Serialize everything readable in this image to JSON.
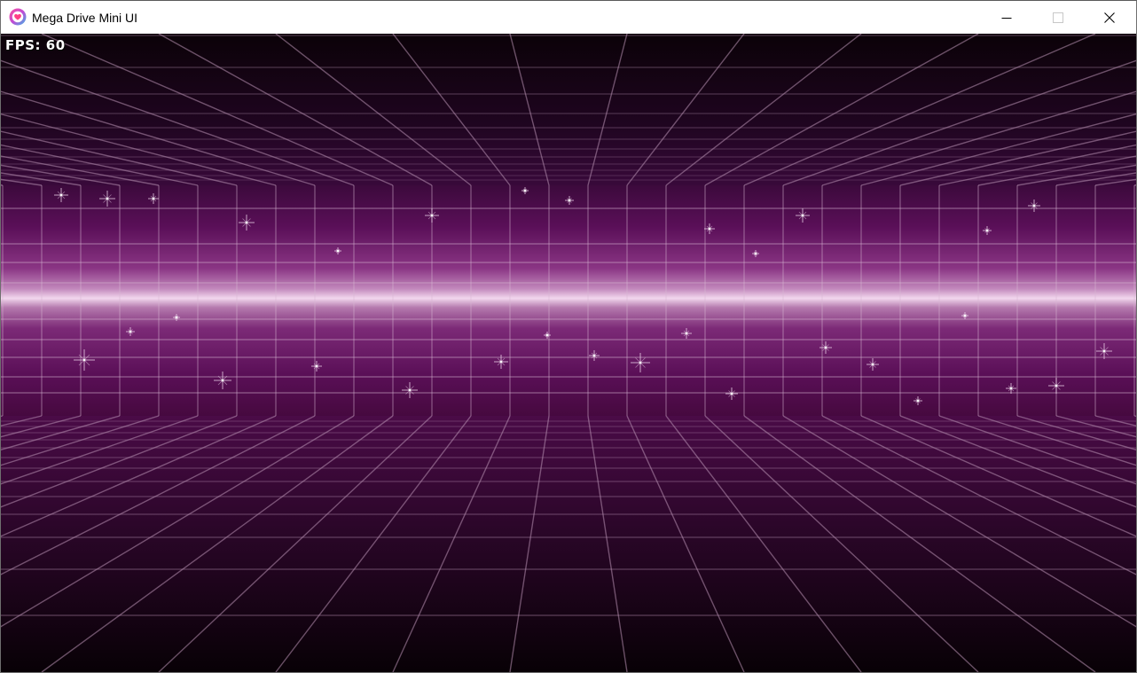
{
  "window": {
    "title": "Mega Drive Mini UI",
    "app_icon": "heart-app-icon",
    "controls": {
      "minimize_icon": "minimize-icon",
      "maximize_icon": "maximize-icon",
      "close_icon": "close-icon"
    }
  },
  "overlay": {
    "fps_text": "FPS: 60"
  },
  "colors": {
    "background_dark": "#0c0208",
    "band_purple": "#5a0f55",
    "band_glow": "#e6c2e2",
    "grid_line": "#b98db4"
  }
}
